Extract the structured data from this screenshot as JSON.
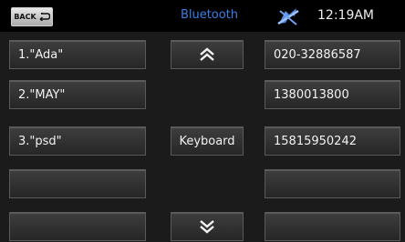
{
  "status": {
    "back_label": "BACK",
    "title": "Bluetooth",
    "time": "12:19AM",
    "bluetooth_icon": "bluetooth-disconnected-icon"
  },
  "contacts": [
    {
      "name": "1.\"Ada\"",
      "number": "020-32886587"
    },
    {
      "name": "2.\"MAY\"",
      "number": "1380013800"
    },
    {
      "name": "3.\"psd\"",
      "number": "15815950242"
    },
    {
      "name": "",
      "number": ""
    },
    {
      "name": "",
      "number": ""
    }
  ],
  "controls": {
    "keyboard_label": "Keyboard",
    "scroll_up_icon": "double-chevron-up-icon",
    "scroll_down_icon": "double-chevron-down-icon"
  },
  "colors": {
    "title_blue": "#3a7fe6",
    "background": "#1b1b1b"
  }
}
